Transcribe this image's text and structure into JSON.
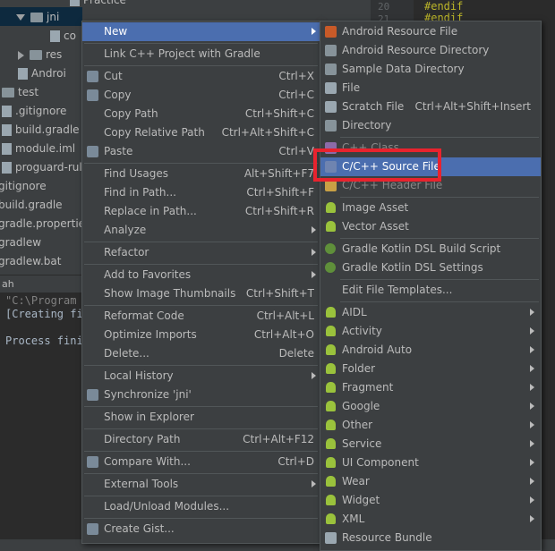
{
  "tree": {
    "rows": [
      {
        "label": "Practice",
        "depth": 4,
        "kind": "file"
      },
      {
        "label": "jni",
        "depth": 1,
        "kind": "folder",
        "expanded": true
      },
      {
        "label": "co",
        "depth": 3,
        "kind": "file"
      },
      {
        "label": "res",
        "depth": 2,
        "kind": "folder",
        "expanded": false
      },
      {
        "label": "Androi",
        "depth": 2,
        "kind": "file"
      },
      {
        "label": "test",
        "depth": 0,
        "kind": "folder",
        "expanded": false
      },
      {
        "label": ".gitignore",
        "depth": 0,
        "kind": "file"
      },
      {
        "label": "build.gradle",
        "depth": 0,
        "kind": "file"
      },
      {
        "label": "module.iml",
        "depth": 0,
        "kind": "file"
      },
      {
        "label": "proguard-rule",
        "depth": 0,
        "kind": "file"
      },
      {
        "label": "gitignore",
        "depth": -1,
        "kind": "file"
      },
      {
        "label": "build.gradle",
        "depth": -1,
        "kind": "file"
      },
      {
        "label": "gradle.properties",
        "depth": -1,
        "kind": "file"
      },
      {
        "label": "gradlew",
        "depth": -1,
        "kind": "file"
      },
      {
        "label": "gradlew.bat",
        "depth": -1,
        "kind": "file"
      }
    ]
  },
  "terminal": {
    "header": "ah",
    "lines": [
      "\"C:\\Program",
      "[Creating fi",
      "",
      "Process fini"
    ]
  },
  "editor": {
    "lines": [
      {
        "num": "20",
        "code": "#endif"
      },
      {
        "num": "21",
        "code": "#endif"
      }
    ]
  },
  "context_menu": {
    "items": [
      {
        "label": "New",
        "shortcut": "",
        "submenu": true,
        "selected": true
      },
      {
        "sep": true
      },
      {
        "label": "Link C++ Project with Gradle",
        "shortcut": ""
      },
      {
        "sep": true
      },
      {
        "label": "Cut",
        "shortcut": "Ctrl+X",
        "icon": "scissors-icon"
      },
      {
        "label": "Copy",
        "shortcut": "Ctrl+C",
        "icon": "copy-icon"
      },
      {
        "label": "Copy Path",
        "shortcut": "Ctrl+Shift+C"
      },
      {
        "label": "Copy Relative Path",
        "shortcut": "Ctrl+Alt+Shift+C"
      },
      {
        "label": "Paste",
        "shortcut": "Ctrl+V",
        "icon": "paste-icon"
      },
      {
        "sep": true
      },
      {
        "label": "Find Usages",
        "shortcut": "Alt+Shift+F7"
      },
      {
        "label": "Find in Path...",
        "shortcut": "Ctrl+Shift+F"
      },
      {
        "label": "Replace in Path...",
        "shortcut": "Ctrl+Shift+R"
      },
      {
        "label": "Analyze",
        "shortcut": "",
        "submenu": true
      },
      {
        "sep": true
      },
      {
        "label": "Refactor",
        "shortcut": "",
        "submenu": true
      },
      {
        "sep": true
      },
      {
        "label": "Add to Favorites",
        "shortcut": "",
        "submenu": true
      },
      {
        "label": "Show Image Thumbnails",
        "shortcut": "Ctrl+Shift+T"
      },
      {
        "sep": true
      },
      {
        "label": "Reformat Code",
        "shortcut": "Ctrl+Alt+L"
      },
      {
        "label": "Optimize Imports",
        "shortcut": "Ctrl+Alt+O"
      },
      {
        "label": "Delete...",
        "shortcut": "Delete"
      },
      {
        "sep": true
      },
      {
        "label": "Local History",
        "shortcut": "",
        "submenu": true
      },
      {
        "label": "Synchronize 'jni'",
        "shortcut": "",
        "icon": "sync-icon"
      },
      {
        "sep": true
      },
      {
        "label": "Show in Explorer",
        "shortcut": ""
      },
      {
        "sep": true
      },
      {
        "label": "Directory Path",
        "shortcut": "Ctrl+Alt+F12"
      },
      {
        "sep": true
      },
      {
        "label": "Compare With...",
        "shortcut": "Ctrl+D",
        "icon": "compare-icon"
      },
      {
        "sep": true
      },
      {
        "label": "External Tools",
        "shortcut": "",
        "submenu": true
      },
      {
        "sep": true
      },
      {
        "label": "Load/Unload Modules...",
        "shortcut": ""
      },
      {
        "sep": true
      },
      {
        "label": "Create Gist...",
        "shortcut": "",
        "icon": "github-icon"
      }
    ]
  },
  "new_submenu": {
    "items": [
      {
        "label": "Android Resource File",
        "icon": "android-resource-file-icon",
        "color": "#c85a28"
      },
      {
        "label": "Android Resource Directory",
        "icon": "folder-icon",
        "color": "#87939a"
      },
      {
        "label": "Sample Data Directory",
        "icon": "folder-icon",
        "color": "#87939a"
      },
      {
        "label": "File",
        "icon": "file-icon",
        "color": "#9aa7b0"
      },
      {
        "label": "Scratch File",
        "shortcut": "Ctrl+Alt+Shift+Insert",
        "icon": "scratch-file-icon",
        "color": "#9aa7b0"
      },
      {
        "label": "Directory",
        "icon": "folder-icon",
        "color": "#87939a"
      },
      {
        "sep": true
      },
      {
        "label": "C++ Class",
        "icon": "cpp-class-icon",
        "color": "#8c6ba8",
        "dim": true
      },
      {
        "label": "C/C++ Source File",
        "icon": "cpp-source-icon",
        "color": "#6f84b0",
        "selected": true
      },
      {
        "label": "C/C++ Header File",
        "icon": "cpp-header-icon",
        "color": "#c9a045",
        "dim": true
      },
      {
        "sep": true
      },
      {
        "label": "Image Asset",
        "icon": "android-icon",
        "color": "#9ac23c"
      },
      {
        "label": "Vector Asset",
        "icon": "android-icon",
        "color": "#9ac23c"
      },
      {
        "sep": true
      },
      {
        "label": "Gradle Kotlin DSL Build Script",
        "icon": "gradle-icon",
        "color": "#5f8f3a"
      },
      {
        "label": "Gradle Kotlin DSL Settings",
        "icon": "gradle-icon",
        "color": "#5f8f3a"
      },
      {
        "sep": true
      },
      {
        "label": "Edit File Templates..."
      },
      {
        "sep": true
      },
      {
        "label": "AIDL",
        "submenu": true,
        "icon": "android-icon",
        "color": "#9ac23c"
      },
      {
        "label": "Activity",
        "submenu": true,
        "icon": "android-icon",
        "color": "#9ac23c"
      },
      {
        "label": "Android Auto",
        "submenu": true,
        "icon": "android-icon",
        "color": "#9ac23c"
      },
      {
        "label": "Folder",
        "submenu": true,
        "icon": "android-icon",
        "color": "#9ac23c"
      },
      {
        "label": "Fragment",
        "submenu": true,
        "icon": "android-icon",
        "color": "#9ac23c"
      },
      {
        "label": "Google",
        "submenu": true,
        "icon": "android-icon",
        "color": "#9ac23c"
      },
      {
        "label": "Other",
        "submenu": true,
        "icon": "android-icon",
        "color": "#9ac23c"
      },
      {
        "label": "Service",
        "submenu": true,
        "icon": "android-icon",
        "color": "#9ac23c"
      },
      {
        "label": "UI Component",
        "submenu": true,
        "icon": "android-icon",
        "color": "#9ac23c"
      },
      {
        "label": "Wear",
        "submenu": true,
        "icon": "android-icon",
        "color": "#9ac23c"
      },
      {
        "label": "Widget",
        "submenu": true,
        "icon": "android-icon",
        "color": "#9ac23c"
      },
      {
        "label": "XML",
        "submenu": true,
        "icon": "android-icon",
        "color": "#9ac23c"
      },
      {
        "label": "Resource Bundle",
        "icon": "resource-bundle-icon",
        "color": "#9aa7b0"
      }
    ]
  },
  "colors": {
    "selection": "#4b6eaf",
    "highlight_box": "#e8232e",
    "menu_bg": "#3c3f41"
  }
}
